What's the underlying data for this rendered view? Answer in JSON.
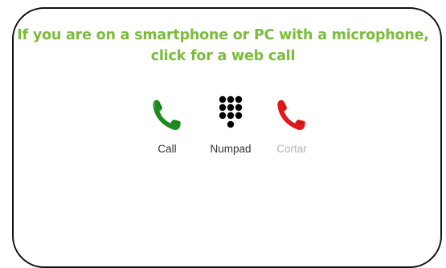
{
  "headline": {
    "line1": "If you are on a smartphone or PC with a microphone,",
    "line2": "click for a web call"
  },
  "controls": [
    {
      "id": "call",
      "label": "Call",
      "icon": "phone-icon",
      "color": "#1f8a1f"
    },
    {
      "id": "numpad",
      "label": "Numpad",
      "icon": "dialpad-icon",
      "color": "#000000"
    },
    {
      "id": "hangup",
      "label": "Cortar",
      "icon": "phone-icon",
      "color": "#e01818",
      "disabled": true
    }
  ],
  "colors": {
    "headline": "#7cbc3a",
    "border": "#111111",
    "label": "#333333",
    "label_disabled": "#b5b5b5"
  }
}
